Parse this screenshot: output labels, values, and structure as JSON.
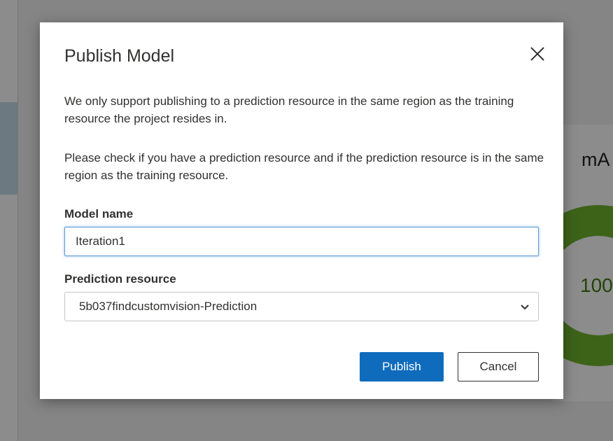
{
  "background": {
    "metric_label": "mA",
    "ring_value": "100"
  },
  "dialog": {
    "title": "Publish Model",
    "close_icon": "close-icon",
    "paragraph_1": "We only support publishing to a prediction resource in the same region as the training resource the project resides in.",
    "paragraph_2": "Please check if you have a prediction resource and if the prediction resource is in the same region as the training resource.",
    "model_name": {
      "label": "Model name",
      "value": "Iteration1"
    },
    "prediction_resource": {
      "label": "Prediction resource",
      "selected": "5b037findcustomvision-Prediction"
    },
    "publish_label": "Publish",
    "cancel_label": "Cancel"
  },
  "colors": {
    "primary": "#0f6cbd",
    "ring": "#6fb42e",
    "focus_border": "#5b9bd5"
  }
}
